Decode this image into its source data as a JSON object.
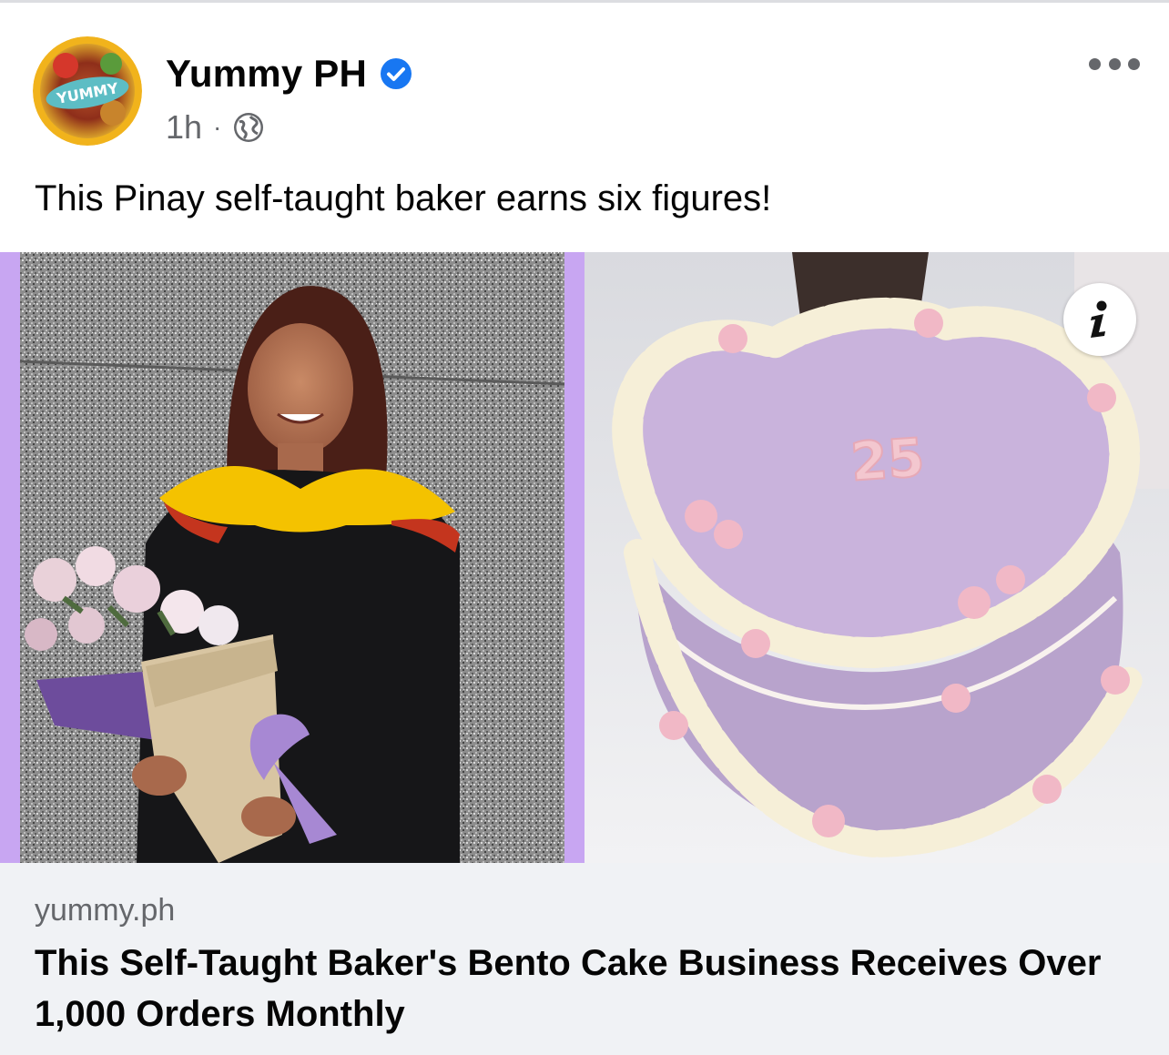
{
  "post": {
    "author_name": "Yummy PH",
    "verified": true,
    "time": "1h",
    "separator": "·",
    "audience_icon": "globe-icon",
    "avatar_logo_text": "YUMMY",
    "text": "This Pinay self-taught baker earns six figures!"
  },
  "image": {
    "cake_topper_text": "25",
    "info_icon": "info-icon"
  },
  "link_preview": {
    "domain": "yummy.ph",
    "headline": "This Self-Taught Baker's Bento Cake Business Receives Over 1,000 Orders Monthly"
  },
  "colors": {
    "verified_blue": "#1877f2",
    "secondary_text": "#65676b",
    "link_bg": "#f0f2f5",
    "frame_purple": "#c8a6f2",
    "cake_purple": "#c9b3dc"
  }
}
